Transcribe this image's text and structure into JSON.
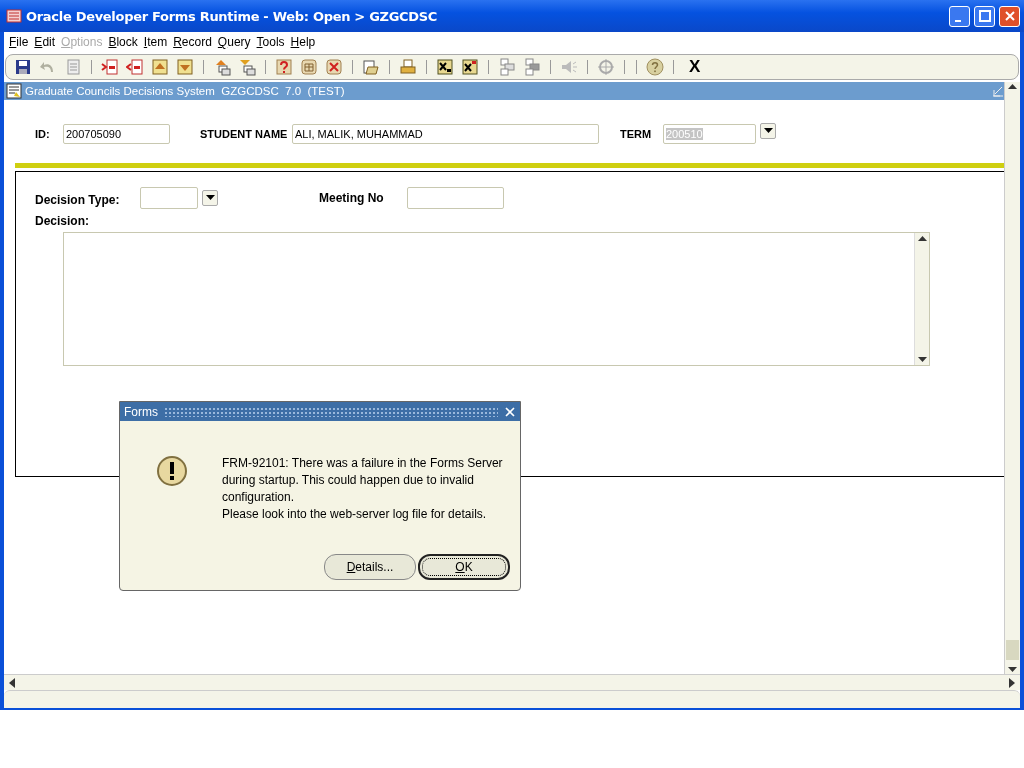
{
  "window": {
    "title": "Oracle Developer Forms Runtime - Web:  Open > GZGCDSC"
  },
  "menu": [
    {
      "label": "File",
      "disabled": false
    },
    {
      "label": "Edit",
      "disabled": false
    },
    {
      "label": "Options",
      "disabled": true
    },
    {
      "label": "Block",
      "disabled": false
    },
    {
      "label": "Item",
      "disabled": false
    },
    {
      "label": "Record",
      "disabled": false
    },
    {
      "label": "Query",
      "disabled": false
    },
    {
      "label": "Tools",
      "disabled": false
    },
    {
      "label": "Help",
      "disabled": false
    }
  ],
  "toolbar": {
    "exit_label": "X"
  },
  "form": {
    "title": "Graduate Councils Decisions System  GZGCDSC  7.0  (TEST)",
    "header_fields": [
      {
        "label": "ID:",
        "value": "200705090",
        "kind": "text",
        "highlighted": false
      },
      {
        "label": "STUDENT NAME",
        "value": "ALI, MALIK, MUHAMMAD",
        "kind": "text",
        "highlighted": false
      },
      {
        "label": "TERM",
        "value": "200510",
        "kind": "dropdown",
        "highlighted": true
      }
    ],
    "detail_fields": [
      {
        "label": "Decision Type:",
        "kind": "dropdown"
      },
      {
        "label": "Meeting No",
        "kind": "text"
      }
    ],
    "decision": {
      "label": "Decision:"
    }
  },
  "dialog": {
    "title": "Forms",
    "message": [
      "FRM-92101: There was a failure in the Forms Server during startup. This could happen due to invalid configuration.",
      "Please look into the web-server log file for details."
    ],
    "buttons": [
      {
        "label": "Details...",
        "default": false
      },
      {
        "label": "OK",
        "default": true
      }
    ]
  }
}
